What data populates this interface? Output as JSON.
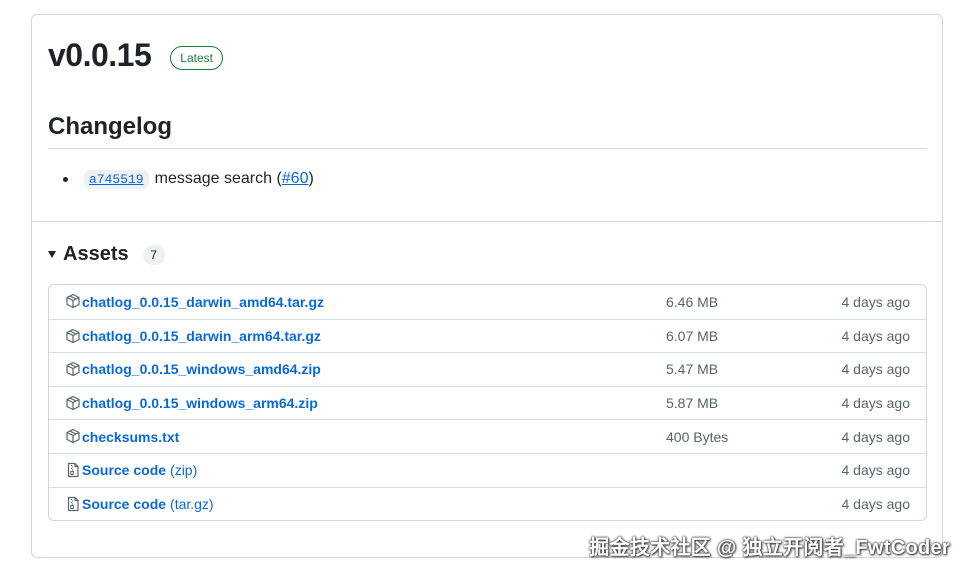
{
  "release": {
    "version": "v0.0.15",
    "latest_label": "Latest",
    "changelog_title": "Changelog",
    "changelog": [
      {
        "sha": "a745519",
        "message": "message search (",
        "pr": "#60",
        "message_end": ")"
      }
    ]
  },
  "assets": {
    "title": "Assets",
    "count": "7",
    "items": [
      {
        "name": "chatlog_0.0.15_darwin_amd64.tar.gz",
        "suffix": "",
        "size": "6.46 MB",
        "date": "4 days ago",
        "icon": "package-icon"
      },
      {
        "name": "chatlog_0.0.15_darwin_arm64.tar.gz",
        "suffix": "",
        "size": "6.07 MB",
        "date": "4 days ago",
        "icon": "package-icon"
      },
      {
        "name": "chatlog_0.0.15_windows_amd64.zip",
        "suffix": "",
        "size": "5.47 MB",
        "date": "4 days ago",
        "icon": "package-icon"
      },
      {
        "name": "chatlog_0.0.15_windows_arm64.zip",
        "suffix": "",
        "size": "5.87 MB",
        "date": "4 days ago",
        "icon": "package-icon"
      },
      {
        "name": "checksums.txt",
        "suffix": "",
        "size": "400 Bytes",
        "date": "4 days ago",
        "icon": "package-icon"
      },
      {
        "name": "Source code",
        "suffix": "(zip)",
        "size": "",
        "date": "4 days ago",
        "icon": "file-zip-icon"
      },
      {
        "name": "Source code",
        "suffix": "(tar.gz)",
        "size": "",
        "date": "4 days ago",
        "icon": "file-zip-icon"
      }
    ]
  },
  "watermark": "掘金技术社区 @ 独立开阅者_FwtCoder",
  "colors": {
    "link": "#0969da",
    "latest_green": "#1a7f37",
    "border": "#d0d7de",
    "muted": "#59636e"
  }
}
